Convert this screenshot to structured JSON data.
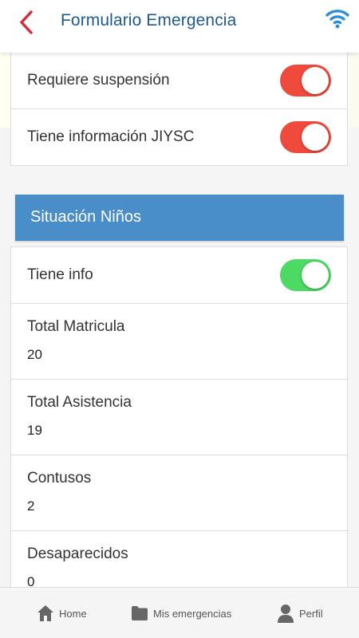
{
  "header": {
    "title": "Formulario Emergencia",
    "back_icon": "chevron-left-icon",
    "status_icon": "wifi-icon"
  },
  "colors": {
    "header_title": "#1e5a8c",
    "back_icon": "#d32f3a",
    "wifi_icon": "#2a8ed8",
    "toggle_on_red": "#ef4a3c",
    "toggle_on_green": "#4cd964",
    "section_header": "#4a8ec9"
  },
  "top_card": {
    "rows": [
      {
        "label": "Requiere suspensión",
        "toggle_on": true,
        "toggle_color": "red"
      },
      {
        "label": "Tiene información JIYSC",
        "toggle_on": true,
        "toggle_color": "red"
      }
    ]
  },
  "section": {
    "title": "Situación Niños"
  },
  "ninos_card": {
    "info_toggle": {
      "label": "Tiene info",
      "toggle_on": true,
      "toggle_color": "green"
    },
    "fields": [
      {
        "label": "Total Matricula",
        "value": "20"
      },
      {
        "label": "Total Asistencia",
        "value": "19"
      },
      {
        "label": "Contusos",
        "value": "2"
      },
      {
        "label": "Desaparecidos",
        "value": "0"
      }
    ]
  },
  "bottom_nav": {
    "items": [
      {
        "label": "Home",
        "icon": "home-icon"
      },
      {
        "label": "Mis emergencias",
        "icon": "folder-icon"
      },
      {
        "label": "Perfil",
        "icon": "person-icon"
      }
    ]
  }
}
